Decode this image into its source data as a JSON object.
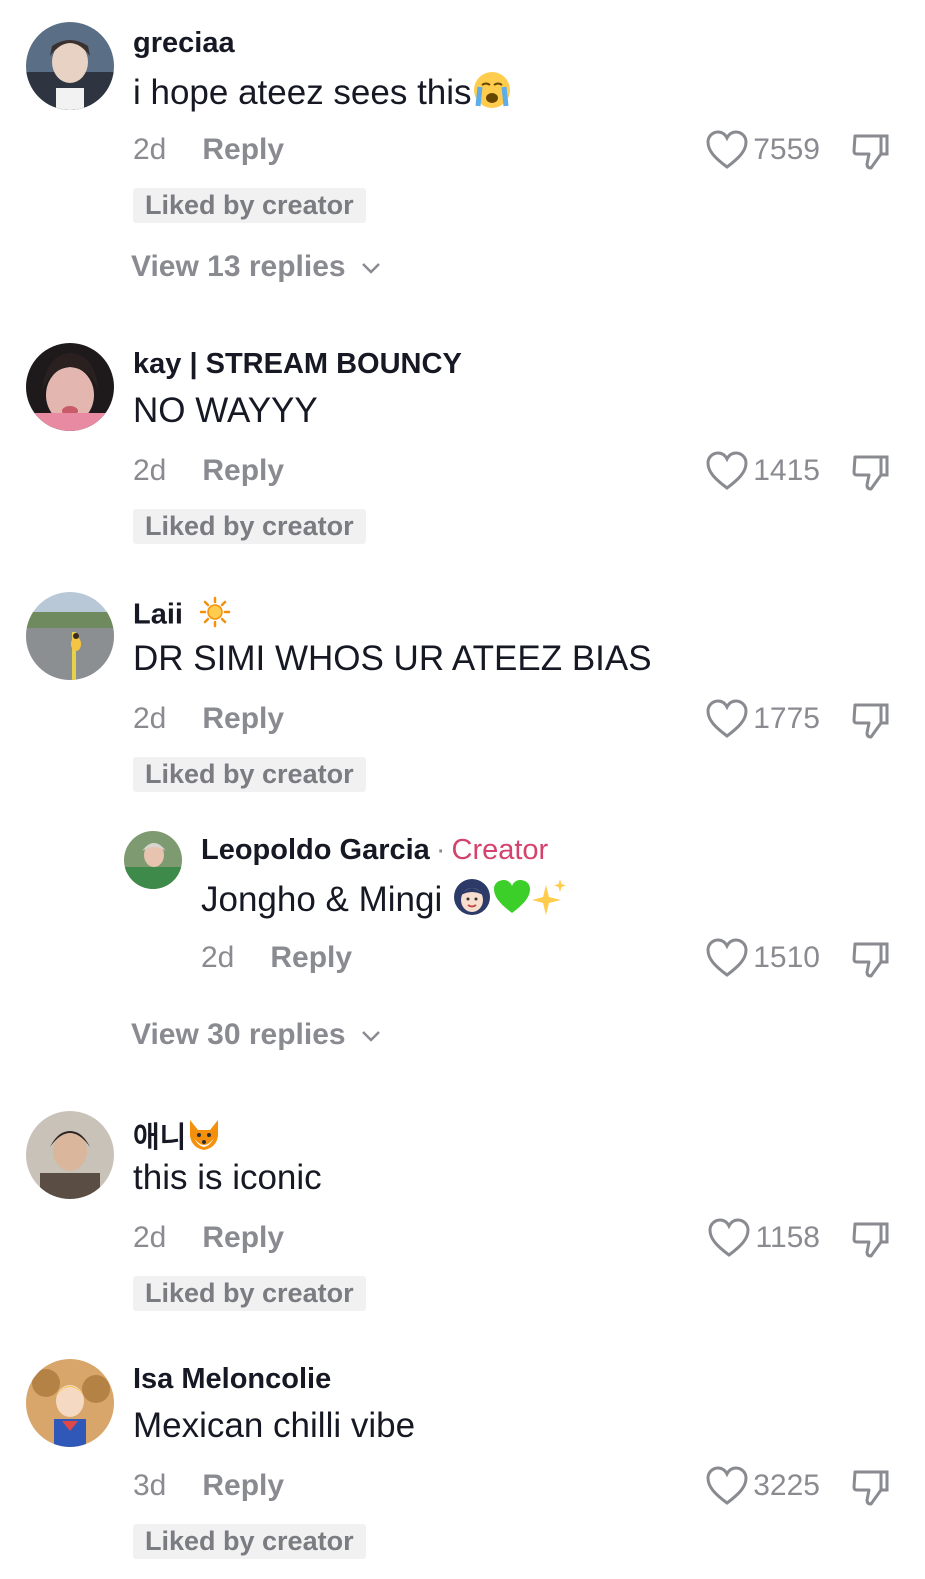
{
  "comments": [
    {
      "username": "greciaa",
      "text": "i hope ateez sees this",
      "text_emoji": "loudly-crying-face",
      "age": "2d",
      "reply_label": "Reply",
      "likes": "7559",
      "liked_by_creator": "Liked by creator",
      "view_replies": "View 13 replies"
    },
    {
      "username": "kay | STREAM BOUNCY",
      "text": "NO WAYYY",
      "age": "2d",
      "reply_label": "Reply",
      "likes": "1415",
      "liked_by_creator": "Liked by creator"
    },
    {
      "username": "Laii",
      "username_badge": "sun-icon",
      "text": "DR SIMI WHOS UR ATEEZ BIAS",
      "age": "2d",
      "reply_label": "Reply",
      "likes": "1775",
      "liked_by_creator": "Liked by creator",
      "reply": {
        "username": "Leopoldo Garcia",
        "separator": "·",
        "creator_label": "Creator",
        "text": "Jongho & Mingi",
        "text_emojis": [
          "person-gesturing-ok",
          "green-heart",
          "sparkles"
        ],
        "age": "2d",
        "reply_label": "Reply",
        "likes": "1510"
      },
      "view_replies": "View 30 replies"
    },
    {
      "username": "애니",
      "username_emoji": "fox-face",
      "text": "this is iconic",
      "age": "2d",
      "reply_label": "Reply",
      "likes": "1158",
      "liked_by_creator": "Liked by creator"
    },
    {
      "username": "Isa Meloncolie",
      "text": "Mexican chilli vibe",
      "age": "3d",
      "reply_label": "Reply",
      "likes": "3225",
      "liked_by_creator": "Liked by creator"
    }
  ],
  "colors": {
    "text": "#161823",
    "secondary": "#8a8b91",
    "creator": "#d4436d",
    "tag_bg": "#f1f1f2"
  }
}
